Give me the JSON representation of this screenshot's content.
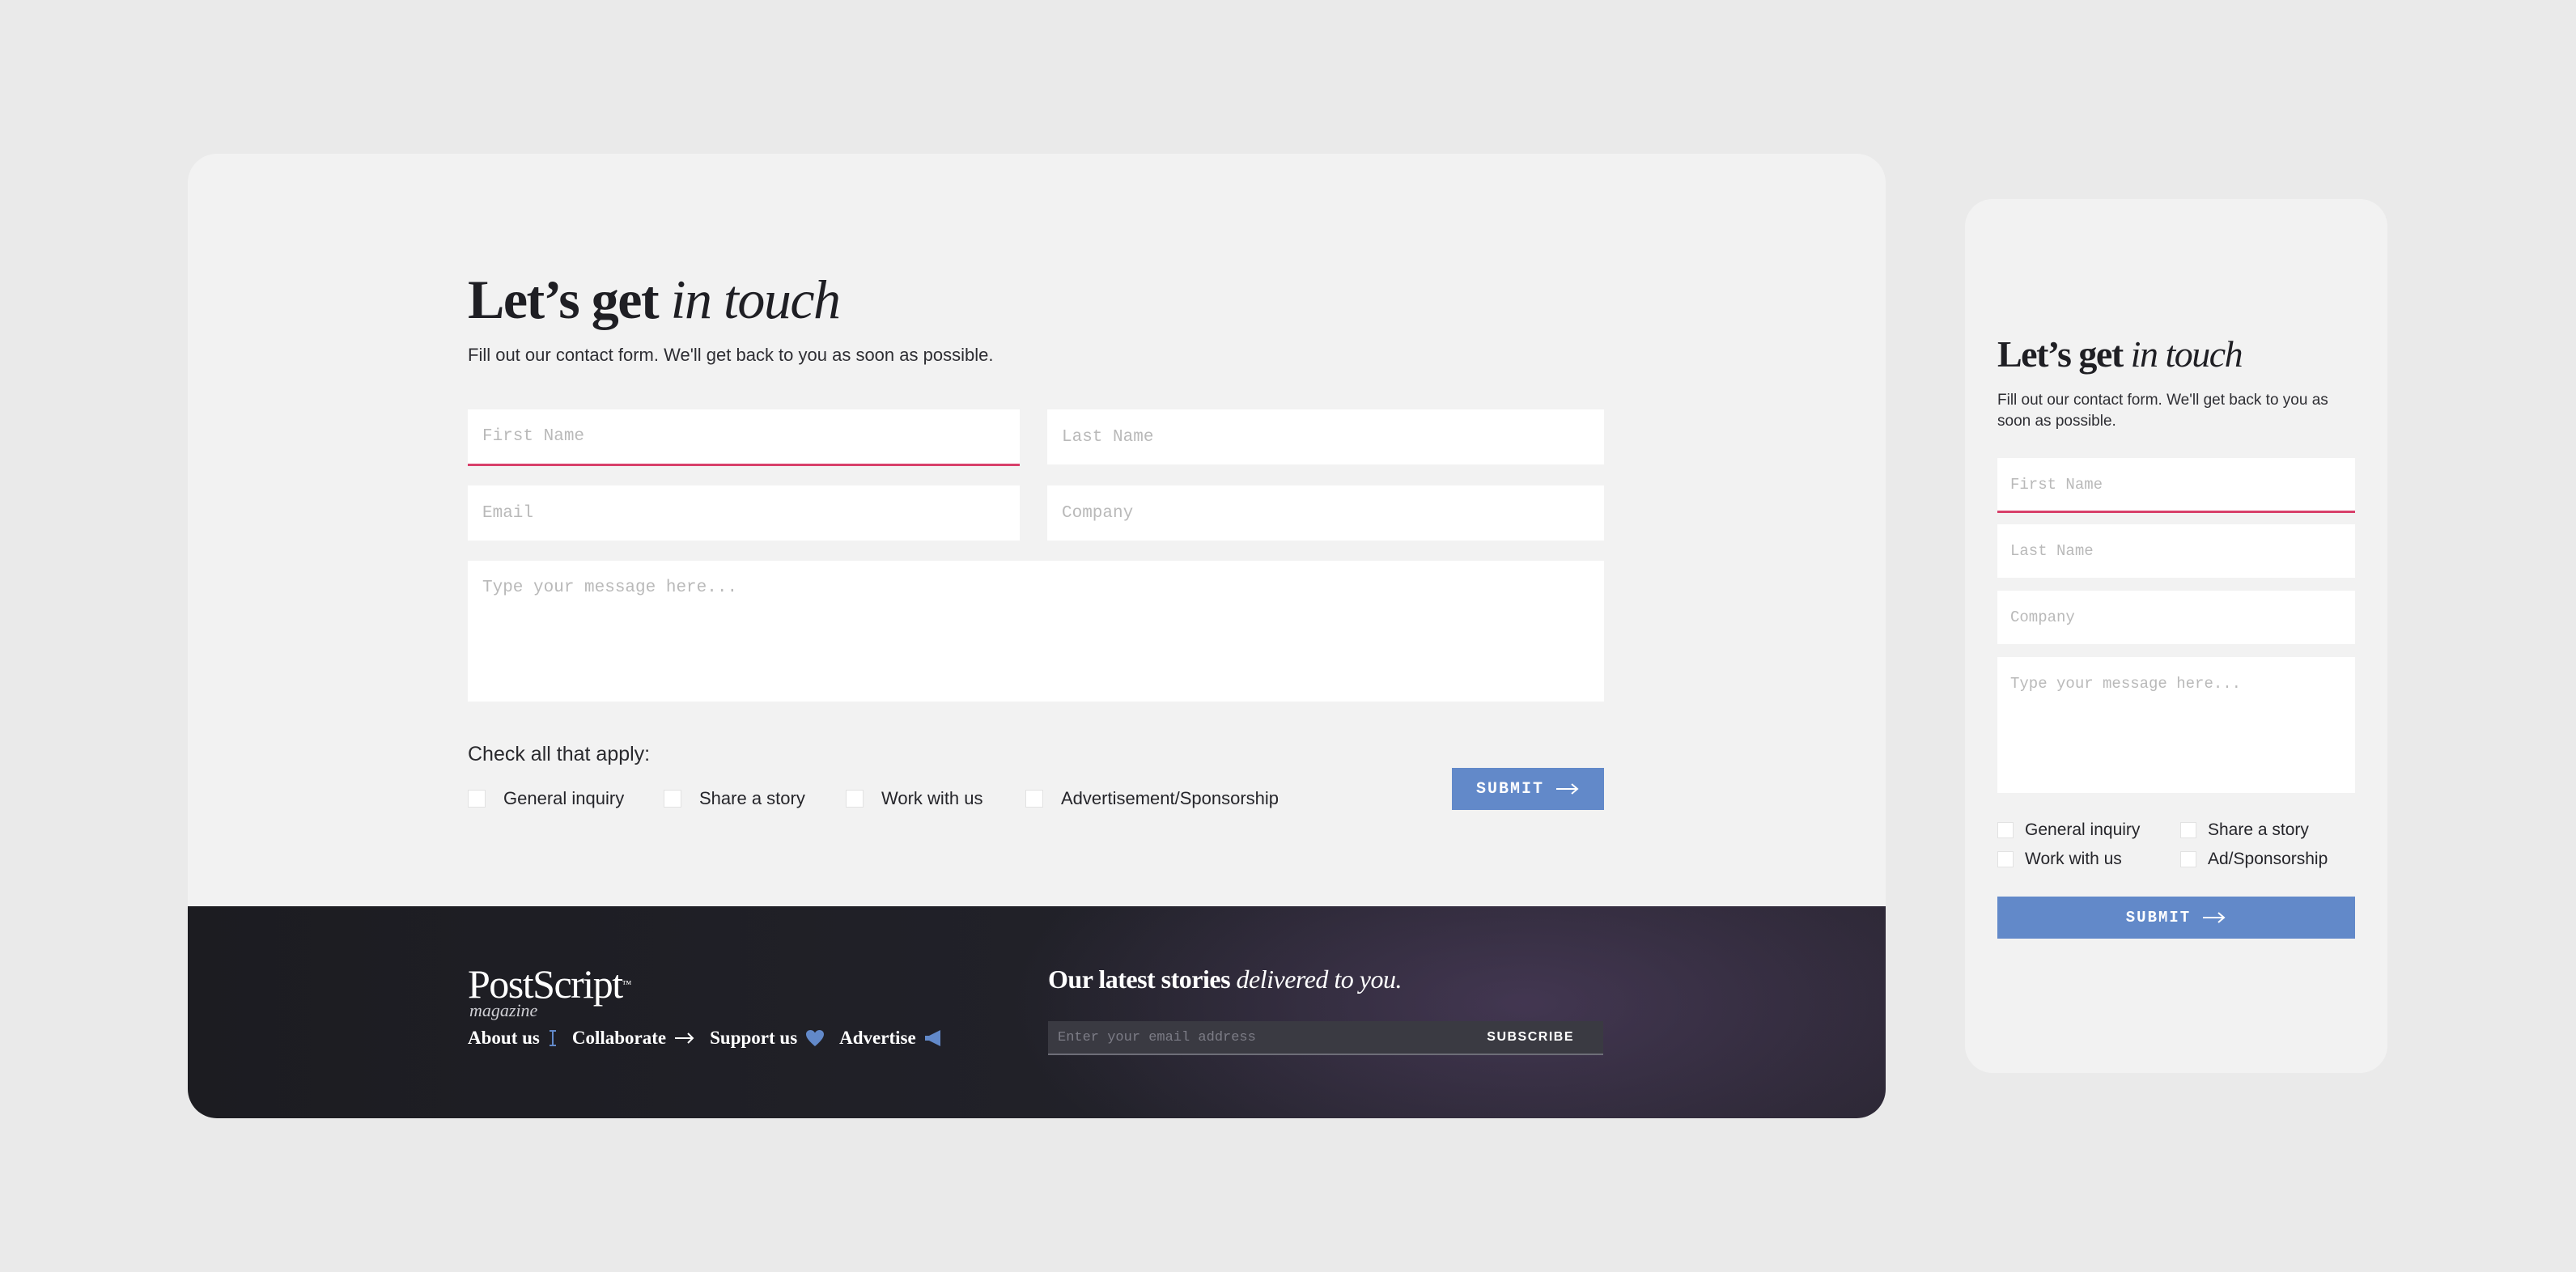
{
  "colors": {
    "accent": "#6289c9",
    "active_underline": "#d8406a",
    "footer_bg": "#1f1f25",
    "card_bg": "#f2f2f2"
  },
  "desktop": {
    "heading_bold": "Let’s get",
    "heading_italic": "in touch",
    "subtitle": "Fill out our contact form. We'll get back to you as soon as possible.",
    "fields": {
      "first_name": "First Name",
      "last_name": "Last Name",
      "email": "Email",
      "company": "Company",
      "message": "Type your message here..."
    },
    "check_title": "Check all that apply:",
    "checkboxes": [
      "General inquiry",
      "Share a story",
      "Work with us",
      "Advertisement/Sponsorship"
    ],
    "submit_label": "SUBMIT",
    "footer": {
      "logo": "PostScript",
      "logo_tm": "™",
      "logo_sub": "magazine",
      "links": [
        {
          "label": "About us",
          "icon": "cursor-icon"
        },
        {
          "label": "Collaborate",
          "icon": "arrow-right-icon"
        },
        {
          "label": "Support us",
          "icon": "heart-icon"
        },
        {
          "label": "Advertise",
          "icon": "megaphone-icon"
        }
      ],
      "newsletter_bold": "Our latest stories",
      "newsletter_italic": "delivered to you.",
      "email_placeholder": "Enter your email address",
      "subscribe_label": "SUBSCRIBE"
    }
  },
  "mobile": {
    "heading_bold": "Let’s get",
    "heading_italic": "in touch",
    "subtitle": "Fill out our contact form. We'll get back to you as soon as possible.",
    "fields": {
      "first_name": "First Name",
      "last_name": "Last Name",
      "company": "Company",
      "message": "Type your message here..."
    },
    "checkboxes": [
      "General inquiry",
      "Share a story",
      "Work with us",
      "Ad/Sponsorship"
    ],
    "submit_label": "SUBMIT"
  }
}
